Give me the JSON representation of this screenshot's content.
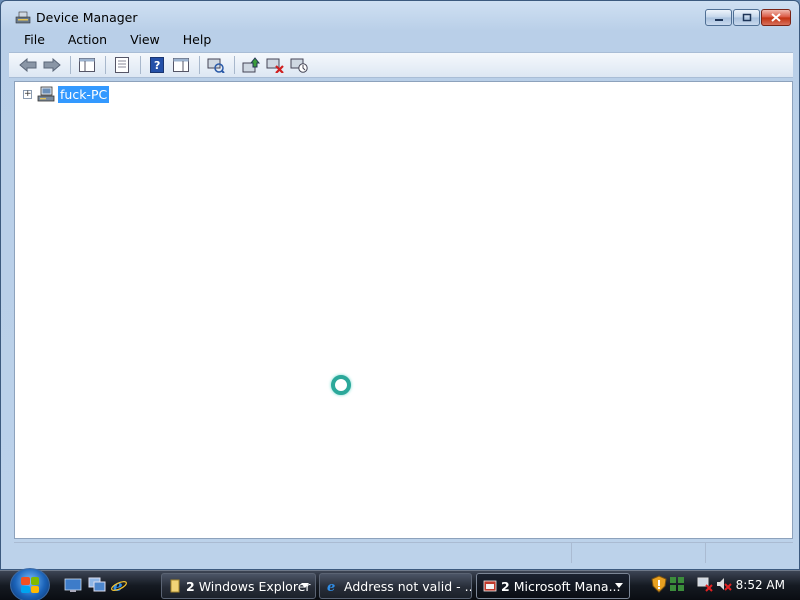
{
  "window": {
    "title": "Device Manager",
    "title_icon": "device-manager-icon"
  },
  "caption_buttons": {
    "minimize": "minimize-icon",
    "maximize": "maximize-icon",
    "close": "close-icon"
  },
  "menu": {
    "items": [
      {
        "label": "File"
      },
      {
        "label": "Action"
      },
      {
        "label": "View"
      },
      {
        "label": "Help"
      }
    ]
  },
  "toolbar": {
    "buttons": [
      "back-arrow-icon",
      "forward-arrow-icon",
      "show-hide-console-tree-icon",
      "properties-icon",
      "help-icon",
      "show-hide-action-pane-icon",
      "scan-hardware-changes-icon",
      "update-driver-icon",
      "uninstall-icon",
      "disable-device-icon"
    ]
  },
  "tree": {
    "root": {
      "expander": "+",
      "icon": "computer-icon",
      "label": "fuck-PC",
      "selected": true
    }
  },
  "cursor": "busy-spinner-icon",
  "taskbar": {
    "start": "windows-start-orb",
    "quick_launch": [
      "show-desktop-icon",
      "switch-windows-icon",
      "internet-explorer-icon"
    ],
    "tasks": [
      {
        "count": "2",
        "label": "Windows Explorer",
        "icon": "folder-icon",
        "active": false
      },
      {
        "count": "",
        "label": "Address not valid - ...",
        "icon": "internet-explorer-icon",
        "active": false
      },
      {
        "count": "2",
        "label": "Microsoft Mana...",
        "icon": "mmc-icon",
        "active": true
      }
    ],
    "tray_icons": [
      "windows-defender-icon",
      "windows-update-icon",
      "network-disconnected-icon",
      "volume-muted-icon"
    ],
    "clock": "8:52 AM"
  },
  "colors": {
    "selection": "#3399ff",
    "close_button": "#c1300f",
    "taskbar": "#151a22"
  }
}
